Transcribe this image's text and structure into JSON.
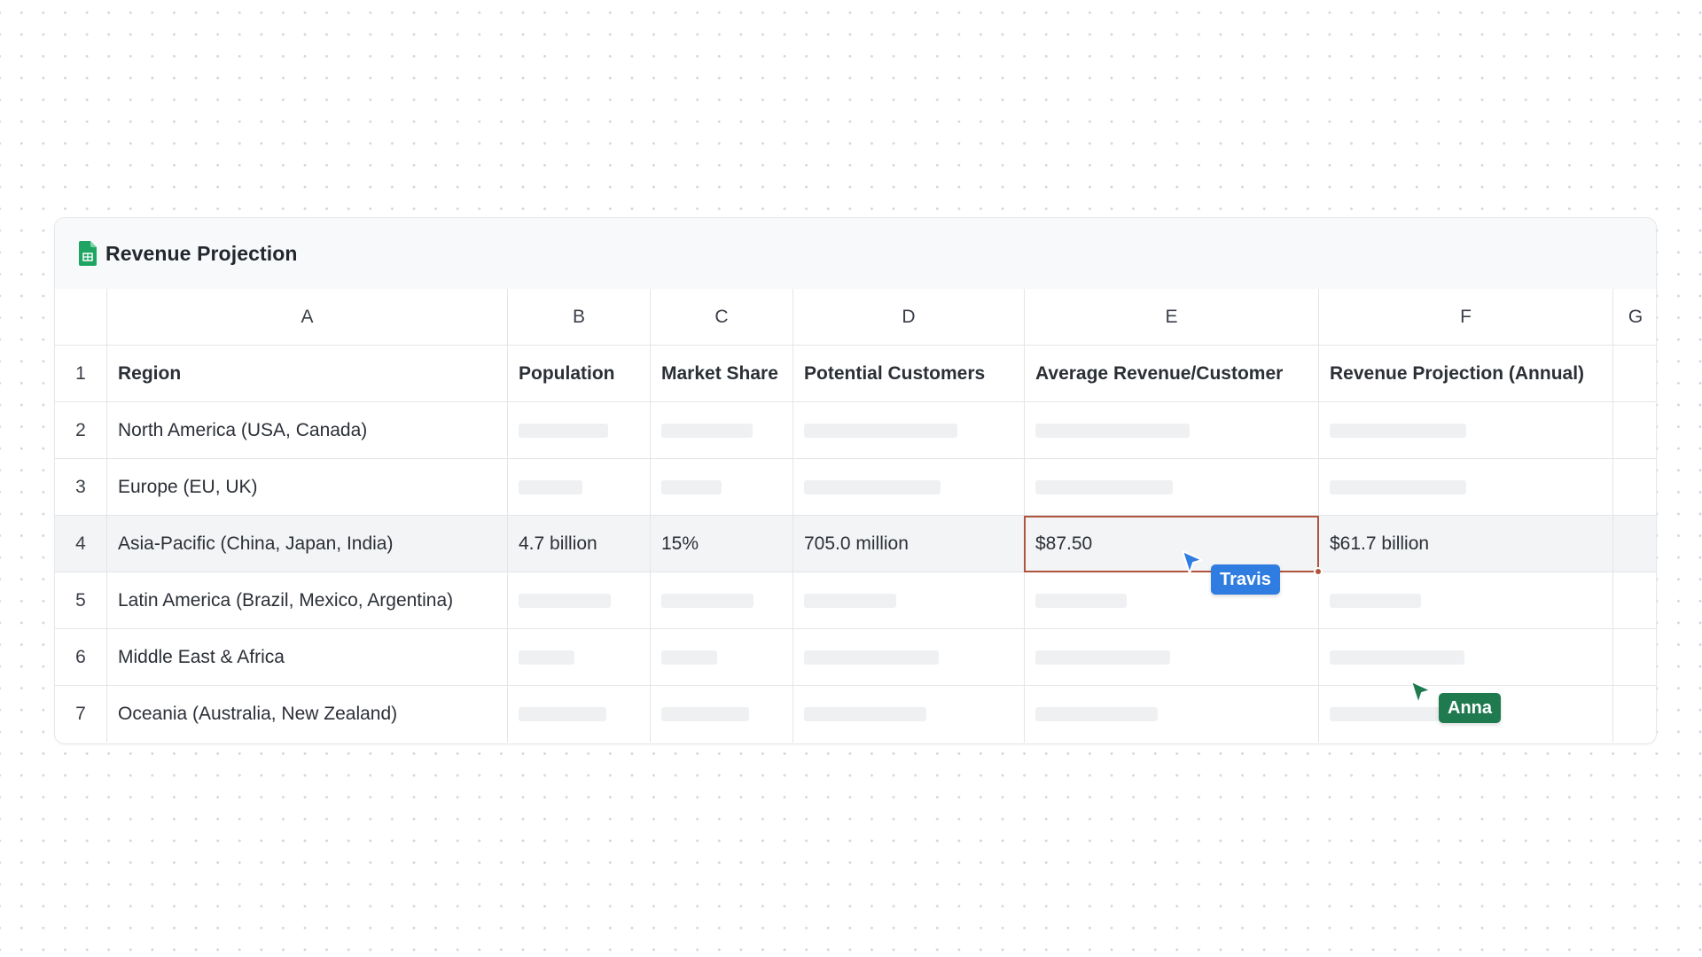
{
  "sheet": {
    "title": "Revenue Projection",
    "icon": "spreadsheet-icon",
    "icon_color": "#1fa463"
  },
  "columns": [
    "A",
    "B",
    "C",
    "D",
    "E",
    "F",
    "G"
  ],
  "header_row": {
    "number": "1",
    "cells": [
      "Region",
      "Population",
      "Market Share",
      "Potential Customers",
      "Average Revenue/Customer",
      "Revenue Projection (Annual)",
      ""
    ]
  },
  "rows": [
    {
      "number": "2",
      "region": "North America (USA, Canada)",
      "values": [
        "",
        "",
        "",
        "",
        ""
      ]
    },
    {
      "number": "3",
      "region": "Europe (EU, UK)",
      "values": [
        "",
        "",
        "",
        "",
        ""
      ]
    },
    {
      "number": "4",
      "region": "Asia-Pacific (China, Japan, India)",
      "values": [
        "4.7 billion",
        "15%",
        "705.0 million",
        "$87.50",
        "$61.7 billion"
      ]
    },
    {
      "number": "5",
      "region": "Latin America (Brazil, Mexico, Argentina)",
      "values": [
        "",
        "",
        "",
        "",
        ""
      ]
    },
    {
      "number": "6",
      "region": "Middle East & Africa",
      "values": [
        "",
        "",
        "",
        "",
        ""
      ]
    },
    {
      "number": "7",
      "region": "Oceania (Australia, New Zealand)",
      "values": [
        "",
        "",
        "",
        "",
        ""
      ]
    }
  ],
  "selection": {
    "cell": "E4",
    "border_color": "#b0543e"
  },
  "collaborators": [
    {
      "name": "Travis",
      "color": "#2f7de1",
      "icon": "cursor-arrow-icon"
    },
    {
      "name": "Anna",
      "color": "#1f7a50",
      "icon": "cursor-arrow-icon"
    }
  ]
}
